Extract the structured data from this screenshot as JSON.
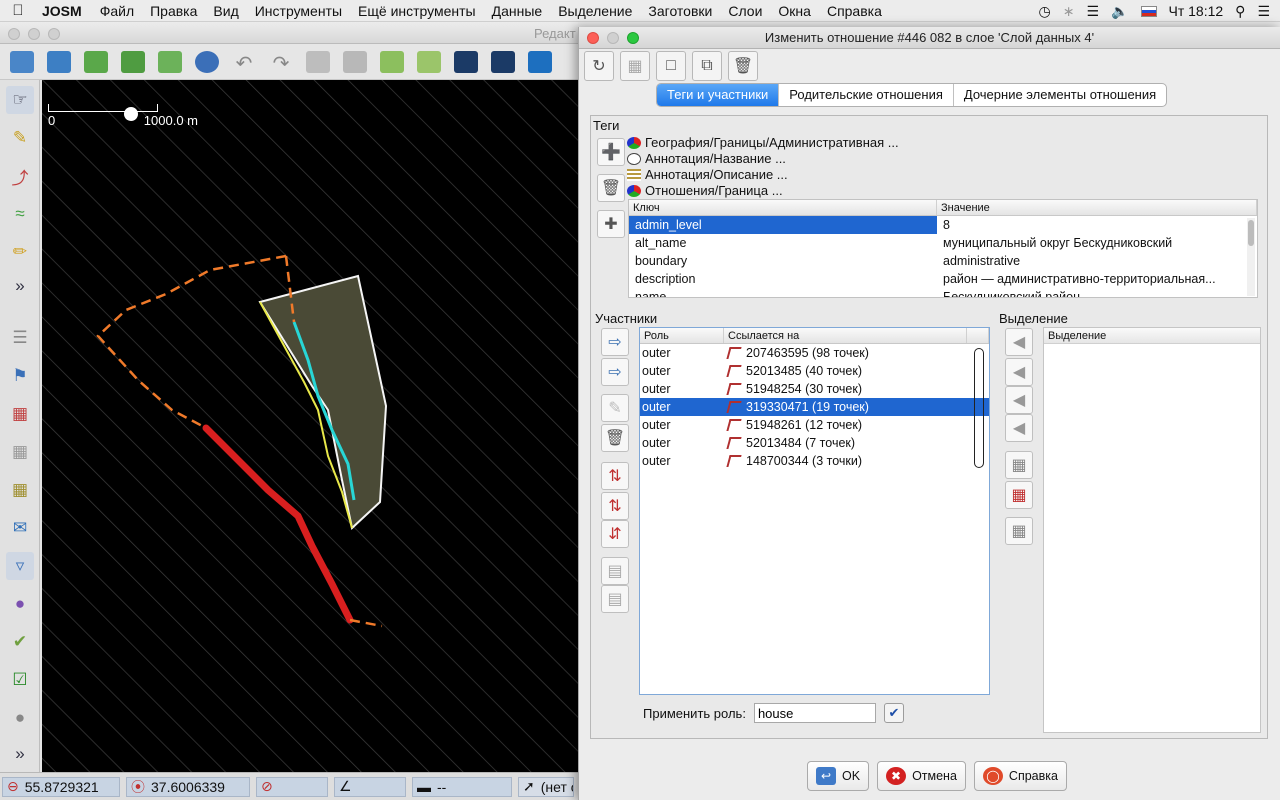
{
  "menubar": {
    "apple": "",
    "app": "JOSM",
    "items": [
      "Файл",
      "Правка",
      "Вид",
      "Инструменты",
      "Ещё инструменты",
      "Данные",
      "Выделение",
      "Заготовки",
      "Слои",
      "Окна",
      "Справка"
    ],
    "clock": "Чт 18:12"
  },
  "mainwin": {
    "title": "Редакт"
  },
  "map": {
    "scale_start": "0",
    "scale_end": "1000.0 m"
  },
  "status": {
    "lat": "55.8729321",
    "lon": "37.6006339",
    "length": "--",
    "select": "(нет о"
  },
  "dialog": {
    "title": "Изменить отношение #446 082 в слое 'Слой данных 4'",
    "tabs": [
      "Теги и участники",
      "Родительские отношения",
      "Дочерние элементы отношения"
    ],
    "tags_label": "Теги",
    "presets": [
      "География/Границы/Административная ...",
      "Аннотация/Название ...",
      "Аннотация/Описание ...",
      "Отношения/Граница ..."
    ],
    "tag_table": {
      "col_key": "Ключ",
      "col_value": "Значение",
      "rows": [
        {
          "k": "admin_level",
          "v": "8"
        },
        {
          "k": "alt_name",
          "v": "муниципальный округ Бескудниковский"
        },
        {
          "k": "boundary",
          "v": "administrative"
        },
        {
          "k": "description",
          "v": "район — административно-территориальная..."
        },
        {
          "k": "name",
          "v": "Бескудниковский район"
        }
      ]
    },
    "members_label": "Участники",
    "members": {
      "col_role": "Роль",
      "col_ref": "Ссылается на",
      "rows": [
        {
          "role": "outer",
          "ref": "207463595 (98 точек)"
        },
        {
          "role": "outer",
          "ref": "52013485 (40 точек)"
        },
        {
          "role": "outer",
          "ref": "51948254 (30 точек)"
        },
        {
          "role": "outer",
          "ref": "319330471 (19 точек)"
        },
        {
          "role": "outer",
          "ref": "51948261 (12 точек)"
        },
        {
          "role": "outer",
          "ref": "52013484 (7 точек)"
        },
        {
          "role": "outer",
          "ref": "148700344 (3 точки)"
        }
      ]
    },
    "selection_label": "Выделение",
    "selection_header": "Выделение",
    "apply_role_label": "Применить роль:",
    "apply_role_value": "house",
    "ok": "OK",
    "cancel": "Отмена",
    "help": "Справка"
  },
  "colors": {
    "accent": "#1f66d0",
    "map_bg": "#000000",
    "boundary": "#f07a2a",
    "selected_way": "#d81f1f"
  }
}
